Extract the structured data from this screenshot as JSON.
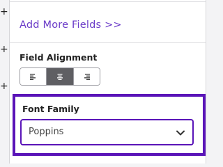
{
  "gutter": {
    "plus_glyph": "+"
  },
  "panel": {
    "add_more_fields": "Add More Fields >>",
    "field_alignment": {
      "label": "Field Alignment",
      "options": [
        {
          "name": "left",
          "icon": "align-left-icon",
          "active": false
        },
        {
          "name": "center",
          "icon": "align-center-icon",
          "active": true
        },
        {
          "name": "right",
          "icon": "align-right-icon",
          "active": false
        }
      ]
    },
    "font_family": {
      "label": "Font Family",
      "selected": "Poppins"
    }
  },
  "colors": {
    "accent_purple": "#5a14b8",
    "link_purple": "#6a3bc8",
    "active_button": "#5f5f63"
  }
}
